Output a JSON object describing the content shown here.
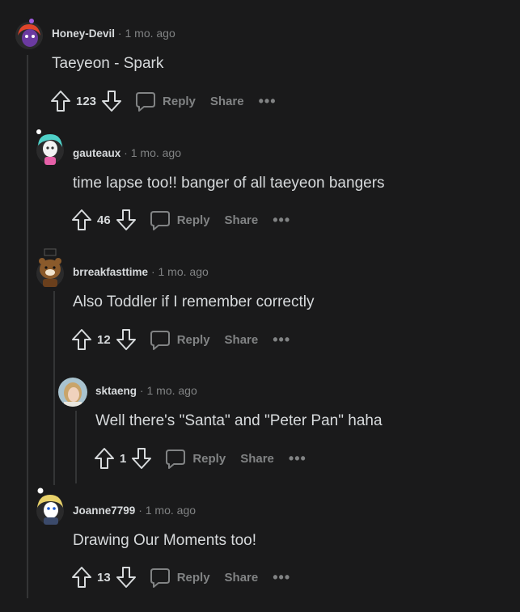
{
  "comments": [
    {
      "author": "Honey-Devil",
      "time": "1 mo. ago",
      "text": "Taeyeon - Spark",
      "votes": "123",
      "avatar_color": "#6b3aa0"
    },
    {
      "author": "gauteaux",
      "time": "1 mo. ago",
      "text": "time lapse too!! banger of all taeyeon bangers",
      "votes": "46",
      "avatar_color": "#4fd0c8"
    },
    {
      "author": "brreakfasttime",
      "time": "1 mo. ago",
      "text": "Also Toddler if I remember correctly",
      "votes": "12",
      "avatar_color": "#8a5a2b"
    },
    {
      "author": "sktaeng",
      "time": "1 mo. ago",
      "text": "Well there's \"Santa\" and \"Peter Pan\" haha",
      "votes": "1",
      "avatar_color": "#c9b59a"
    },
    {
      "author": "Joanne7799",
      "time": "1 mo. ago",
      "text": "Drawing Our Moments too!",
      "votes": "13",
      "avatar_color": "#e8d16a"
    }
  ],
  "labels": {
    "separator": "·",
    "reply": "Reply",
    "share": "Share",
    "more": "•••"
  },
  "icons": {
    "upvote": "arrow-up-icon",
    "downvote": "arrow-down-icon",
    "reply": "speech-bubble-icon",
    "more": "more-horizontal-icon"
  }
}
